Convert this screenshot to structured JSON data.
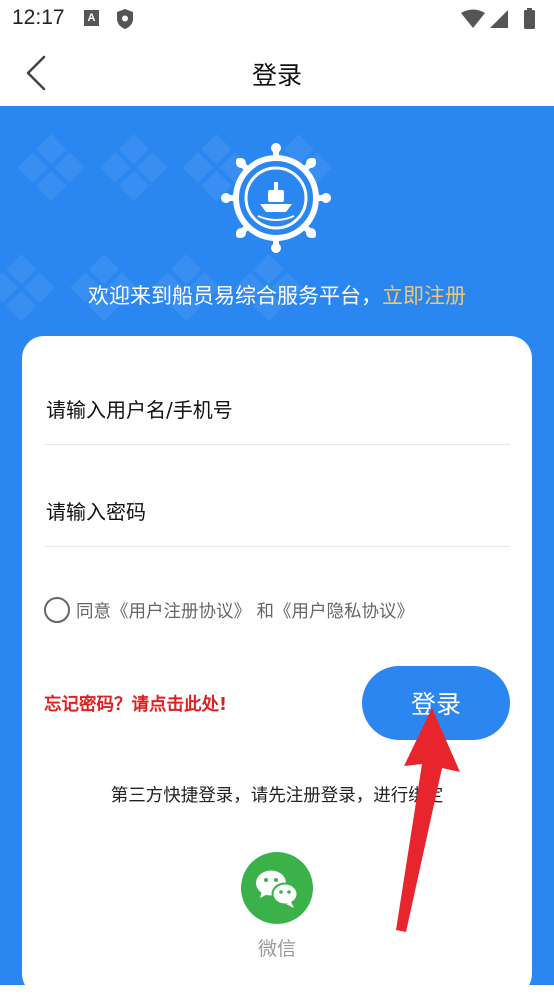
{
  "status_bar": {
    "time": "12:17",
    "a_icon": "A",
    "icons": [
      "a-icon",
      "shield-icon",
      "wifi-icon",
      "signal-icon",
      "battery-icon"
    ]
  },
  "header": {
    "title": "登录",
    "back_icon": "chevron-left-icon"
  },
  "hero": {
    "logo_icon": "ship-wheel-icon",
    "welcome_text": "欢迎来到船员易综合服务平台，",
    "register_link": "立即注册",
    "bg_color": "#2a86f0",
    "link_color": "#f8c56a"
  },
  "form": {
    "username_placeholder": "请输入用户名/手机号",
    "password_placeholder": "请输入密码",
    "agreement_text": "同意《用户注册协议》 和《用户隐私协议》",
    "forgot_password": "忘记密码？请点击此处!",
    "login_button": "登录",
    "third_party_text": "第三方快捷登录，请先注册登录，进行绑定",
    "wechat_label": "微信",
    "wechat_icon": "wechat-icon"
  },
  "colors": {
    "accent": "#2b86f1",
    "warning": "#e02020",
    "wechat": "#3bb14a",
    "arrow": "#e8242c"
  }
}
